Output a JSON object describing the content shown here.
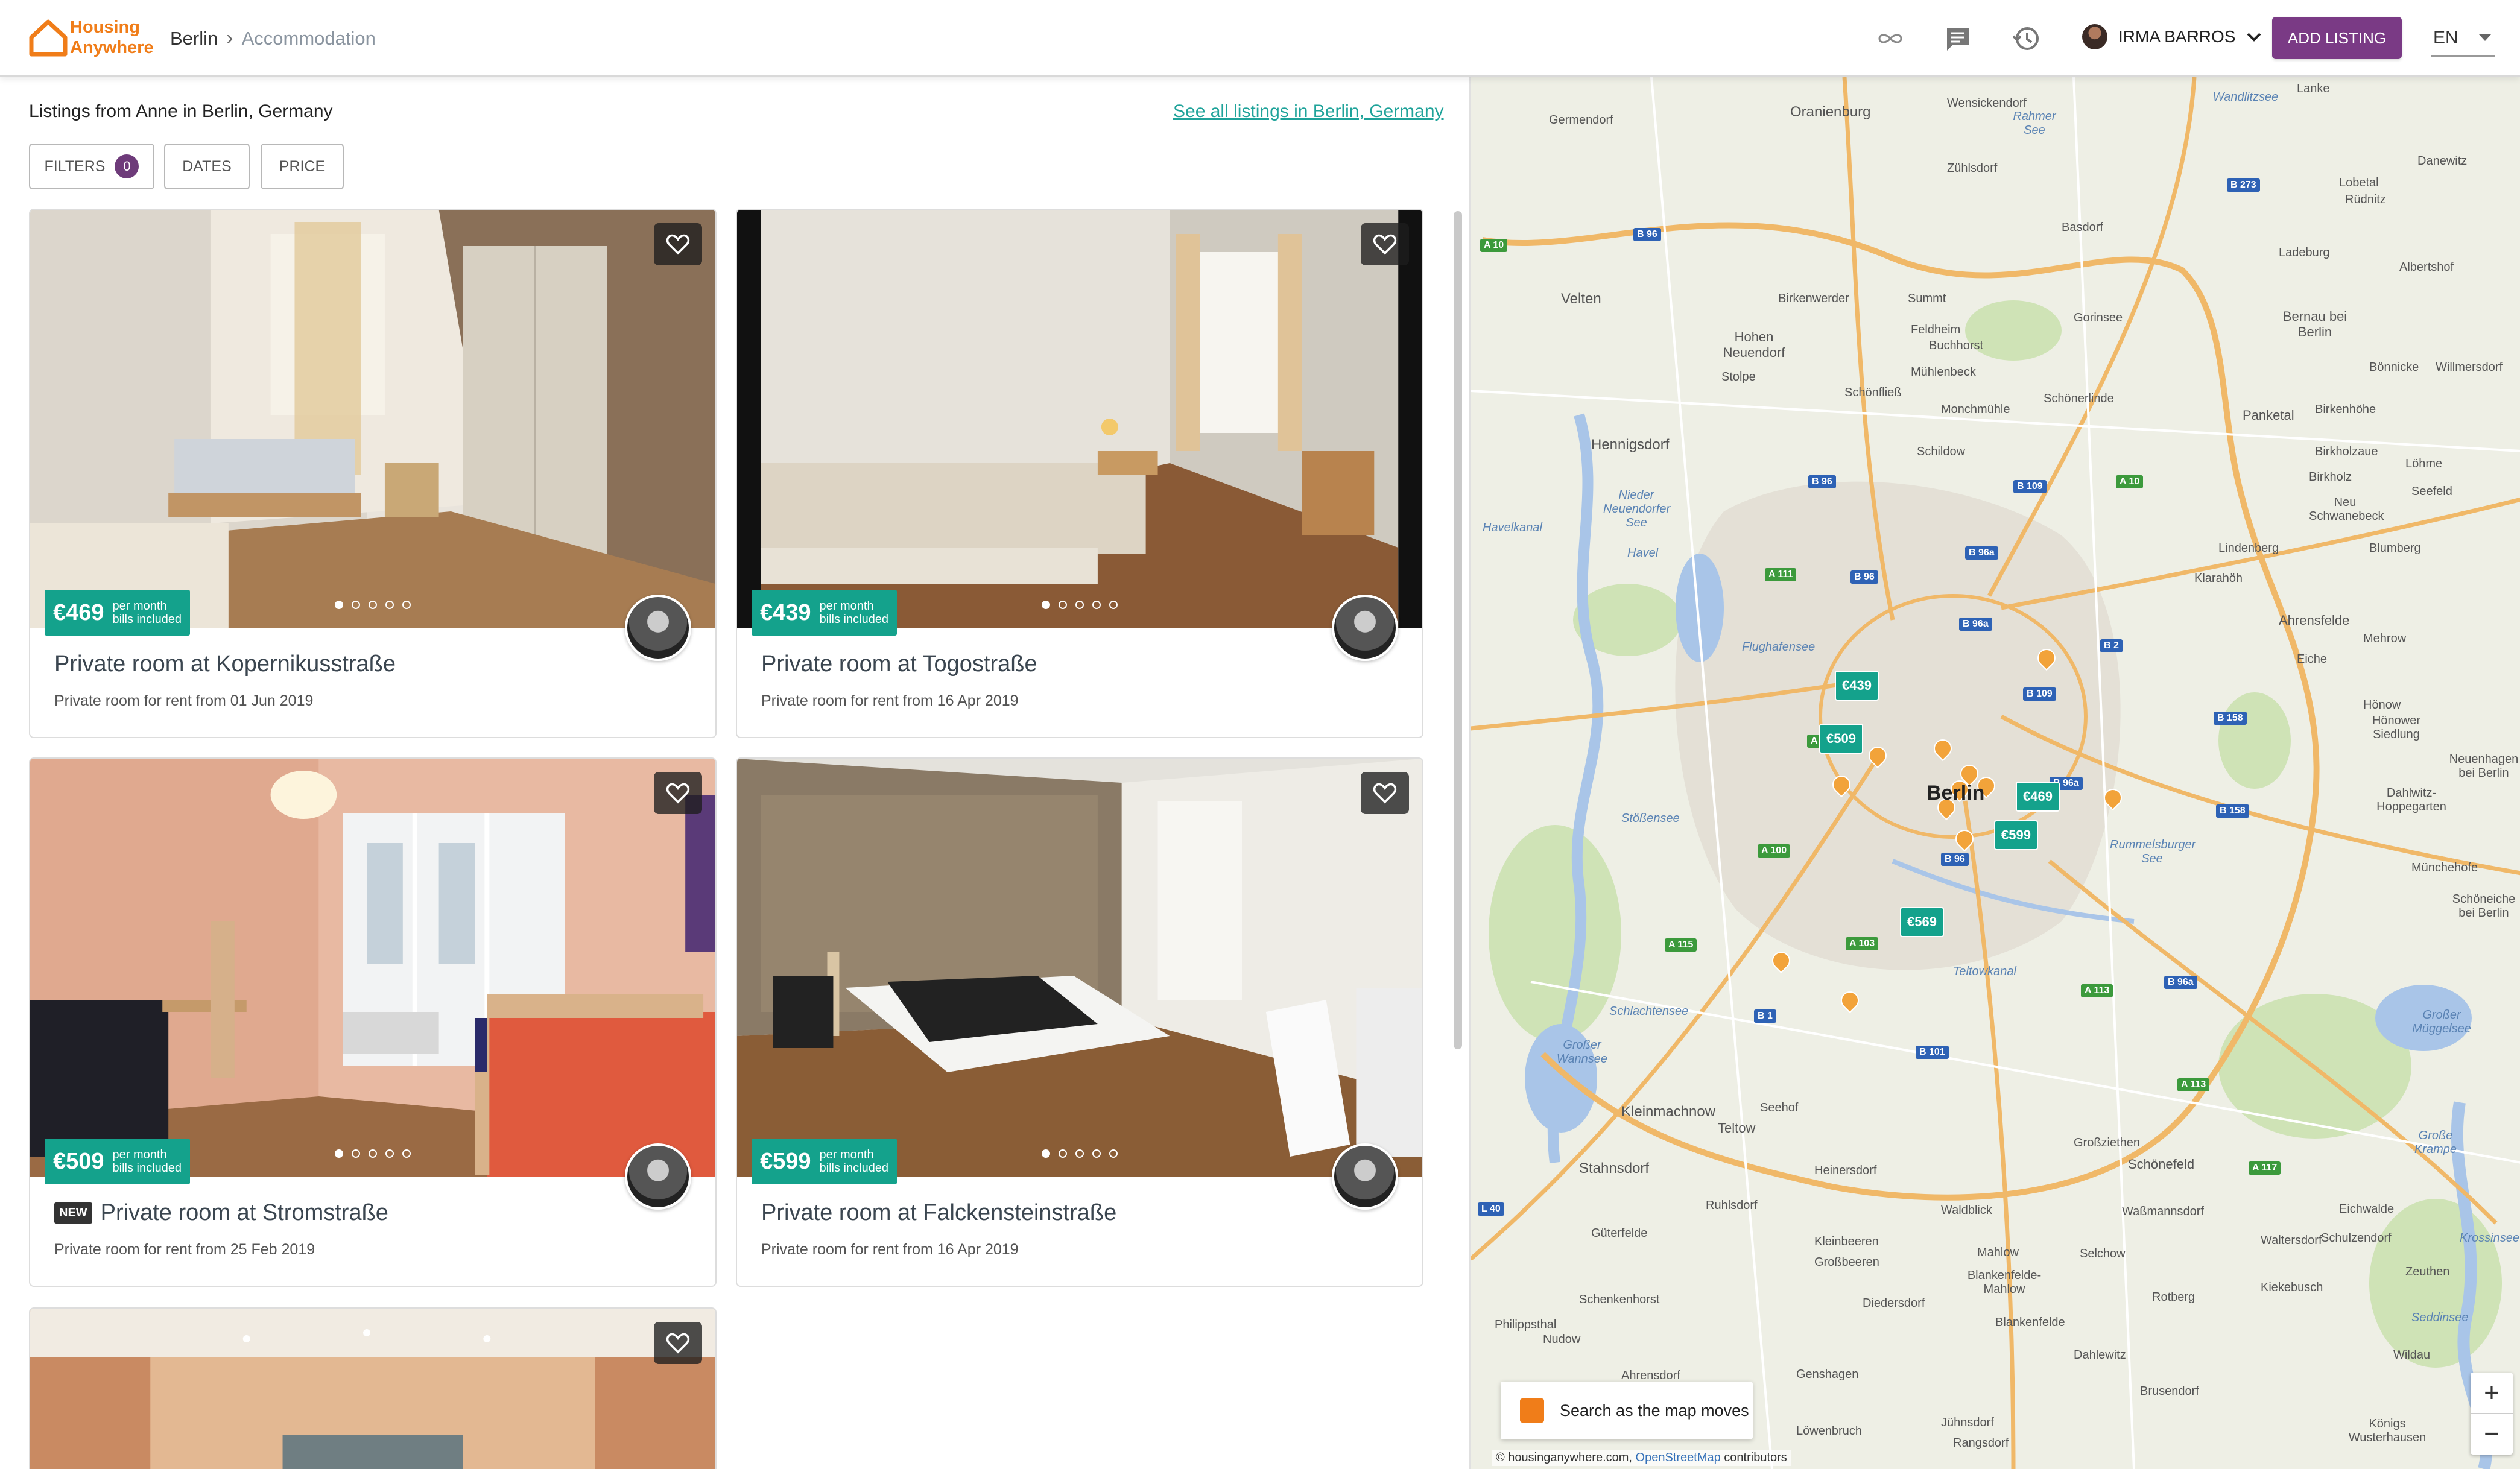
{
  "header": {
    "logo_line1": "Housing",
    "logo_line2": "Anywhere",
    "breadcrumb": [
      "Berlin",
      "Accommodation"
    ],
    "user_name": "IRMA BARROS",
    "add_listing_label": "ADD LISTING",
    "language": "EN"
  },
  "listing_header": {
    "title": "Listings from Anne in Berlin, Germany",
    "see_all_link": "See all listings in Berlin, Germany"
  },
  "filters": {
    "filters_label": "FILTERS",
    "filters_count": "0",
    "dates_label": "DATES",
    "price_label": "PRICE"
  },
  "cards": [
    {
      "price": "€469",
      "price_note_1": "per month",
      "price_note_2": "bills included",
      "title": "Private room at Kopernikusstraße",
      "subtitle": "Private room for rent from 01 Jun 2019",
      "new": false
    },
    {
      "price": "€439",
      "price_note_1": "per month",
      "price_note_2": "bills included",
      "title": "Private room at Togostraße",
      "subtitle": "Private room for rent from 16 Apr 2019",
      "new": false
    },
    {
      "price": "€509",
      "price_note_1": "per month",
      "price_note_2": "bills included",
      "title": "Private room at Stromstraße",
      "subtitle": "Private room for rent from 25 Feb 2019",
      "new": true,
      "new_label": "NEW"
    },
    {
      "price": "€599",
      "price_note_1": "per month",
      "price_note_2": "bills included",
      "title": "Private room at Falckensteinstraße",
      "subtitle": "Private room for rent from 16 Apr 2019",
      "new": false
    }
  ],
  "map": {
    "city_label": "Berlin",
    "price_markers": [
      "€439",
      "€509",
      "€469",
      "€599",
      "€569"
    ],
    "place_labels": [
      "Oranienburg",
      "Germendorf",
      "Wensickendorf",
      "Zühlsdorf",
      "Lanke",
      "Danewitz",
      "Lobetal",
      "Rüdnitz",
      "Velten",
      "Birkenwerder",
      "Summt",
      "Basdorf",
      "Ladeburg",
      "Albertshof",
      "Hohen Neuendorf",
      "Stolpe",
      "Feldheim",
      "Buchhorst",
      "Mühlenbeck",
      "Gorinsee",
      "Bernau bei Berlin",
      "Schönfließ",
      "Schönerlinde",
      "Bönnicke",
      "Willmersdorf",
      "Hennigsdorf",
      "Schildow",
      "Monchmühle",
      "Panketal",
      "Birkenhöhe",
      "Birkholzaue",
      "Löhme",
      "Seefeld",
      "Birkholz",
      "Neu Schwanebeck",
      "Lindenberg",
      "Blumberg",
      "Klarahöh",
      "Ahrensfelde",
      "Mehrow",
      "Eiche",
      "Hönow",
      "Hönower Siedlung",
      "Neuenhagen bei Berlin",
      "Dahlwitz-Hoppegarten",
      "Münchehofe",
      "Schöneiche bei Berlin",
      "Kleinmachnow",
      "Teltow",
      "Seehof",
      "Stahnsdorf",
      "Ruhlsdorf",
      "Heinersdorf",
      "Großziethen",
      "Schönefeld",
      "Waßmannsdorf",
      "Eichwalde",
      "Schulzendorf",
      "Waltersdorf",
      "Zeuthen",
      "Güterfelde",
      "Kleinbeeren",
      "Großbeeren",
      "Mahlow",
      "Blankenfelde-Mahlow",
      "Selchow",
      "Kiekebusch",
      "Schenkenhorst",
      "Diedersdorf",
      "Rotberg",
      "Blankenfelde",
      "Philippsthal",
      "Nudow",
      "Dahlewitz",
      "Wildau",
      "Ahrensdorf",
      "Genshagen",
      "Brusendorf",
      "Löwenbruch",
      "Jühnsdorf",
      "Rangsdorf",
      "Königs Wusterhausen",
      "Waldblick"
    ],
    "water_labels": [
      "Havelkanal",
      "Nieder Neuendorfer See",
      "Havel",
      "Flughafensee",
      "Stößensee",
      "Schlachtensee",
      "Großer Wannsee",
      "Teltowkanal",
      "Rummelsburger See",
      "Großer Müggelsee",
      "Große Krampe",
      "Krossinsee",
      "Seddinsee",
      "Rahmer See",
      "Wandlitzsee"
    ],
    "road_labels": [
      "A 10",
      "B 96",
      "B 273",
      "B 96",
      "B 109",
      "A 10",
      "A 111",
      "B 96",
      "B 96a",
      "B 96a",
      "B 2",
      "B 109",
      "A 10",
      "B 96a",
      "B 158",
      "B 158",
      "A 100",
      "B 96",
      "A 115",
      "A 103",
      "B 96a",
      "A 113",
      "B 1",
      "B 101",
      "A 113",
      "A 117",
      "L 40"
    ],
    "search_moves_label": "Search as the map moves",
    "attribution_1": "© housinganywhere.com, ",
    "attribution_link": "OpenStreetMap",
    "attribution_2": " contributors",
    "zoom_in": "+",
    "zoom_out": "−"
  },
  "colors": {
    "brand_orange": "#f07d19",
    "accent_purple": "#7a3a85",
    "price_green": "#14a28c",
    "link_teal": "#1fa39a"
  }
}
